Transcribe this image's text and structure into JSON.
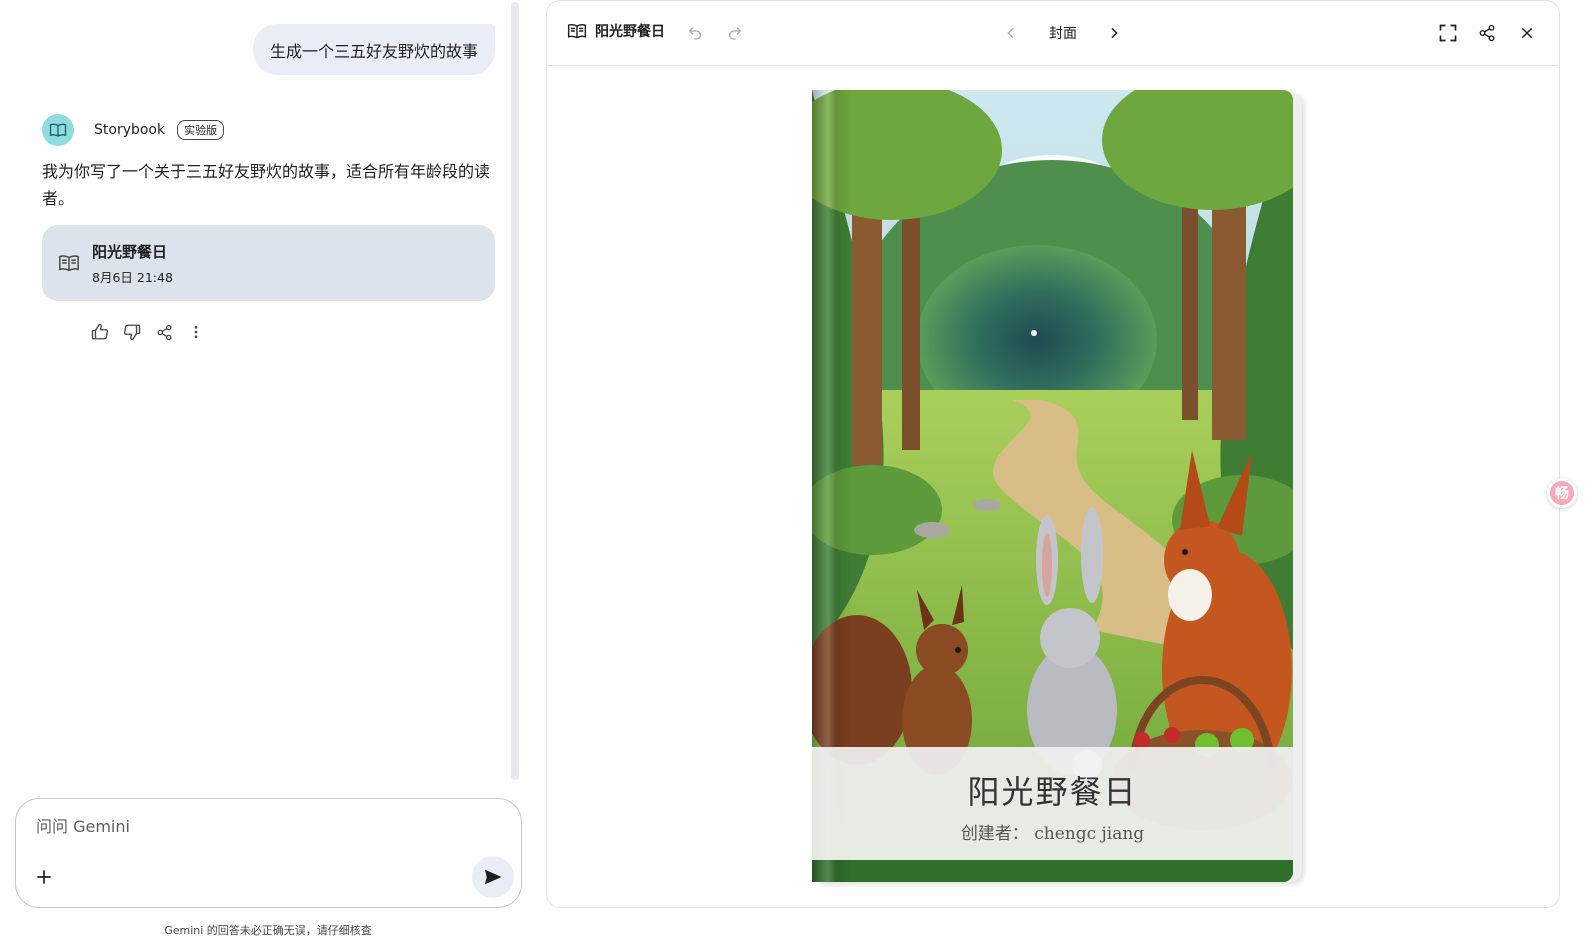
{
  "chat": {
    "user_message": "生成一个三五好友野炊的故事",
    "agent": {
      "name": "Storybook",
      "badge": "实验版"
    },
    "reply": "我为你写了一个关于三五好友野炊的故事，适合所有年龄段的读者。",
    "card": {
      "title": "阳光野餐日",
      "date": "8月6日 21:48"
    },
    "input_placeholder": "问问 Gemini",
    "disclaimer": "Gemini 的回答未必正确无误，请仔细核查"
  },
  "canvas": {
    "title": "阳光野餐日",
    "page_label": "封面",
    "cover": {
      "title": "阳光野餐日",
      "author_label": "创建者：",
      "author": "chengc jiang"
    }
  },
  "colors": {
    "avatar": "#8fdcdf",
    "user_bubble": "#e9eef6",
    "card_bg": "#dde3ea",
    "float_chip": "#f6a9b8"
  },
  "icons": [
    "book-icon",
    "undo-icon",
    "redo-icon",
    "chevron-left-icon",
    "chevron-right-icon",
    "fullscreen-icon",
    "share-icon",
    "close-icon",
    "thumbs-up-icon",
    "thumbs-down-icon",
    "more-vert-icon",
    "plus-icon",
    "send-icon"
  ],
  "float_chip_text": "畅"
}
